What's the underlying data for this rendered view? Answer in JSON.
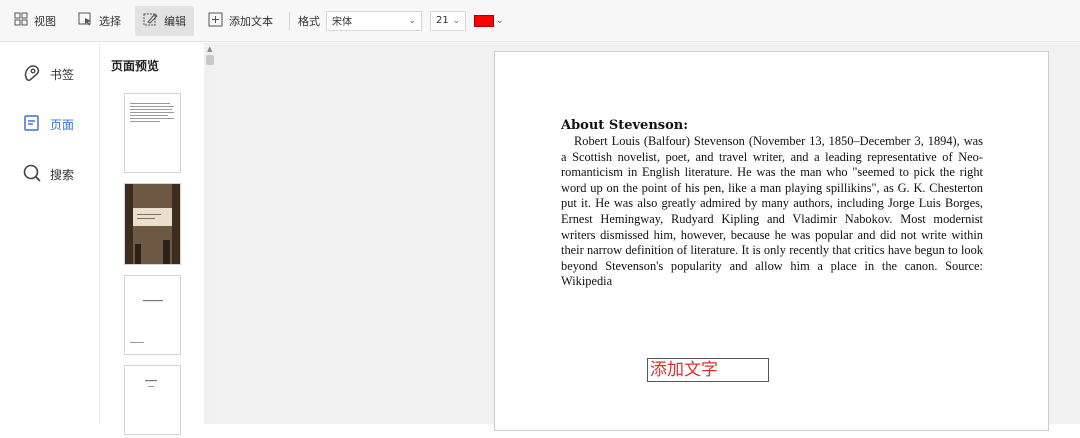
{
  "toolbar": {
    "view_label": "视图",
    "select_label": "选择",
    "edit_label": "编辑",
    "add_text_label": "添加文本",
    "format_label": "格式",
    "font_value": "宋体",
    "size_value": "21",
    "text_color": "#ff0000"
  },
  "sidebar": {
    "items": [
      {
        "label": "书签",
        "icon": "bookmark-icon"
      },
      {
        "label": "页面",
        "icon": "pages-icon"
      },
      {
        "label": "搜索",
        "icon": "search-icon"
      }
    ],
    "active_index": 1
  },
  "thumbnails": {
    "title": "页面预览",
    "count_visible": 4
  },
  "document": {
    "heading": "About Stevenson:",
    "paragraph": "Robert Louis (Balfour) Stevenson (November 13, 1850–December 3, 1894), was a Scottish novelist, poet, and travel writer, and a leading representative of Neo-romanticism in English literature. He was the man who \"seemed to pick the right word up on the point of his pen, like a man playing spillikins\", as G. K. Chesterton put it. He was also greatly admired by many authors, including Jorge Luis Borges, Ernest Hemingway, Rudyard Kipling and Vladimir Nabokov. Most modernist writers dismissed him, however, because he was popular and did not write within their narrow definition of literature. It is only recently that critics have begun to look beyond Stevenson's popularity and allow him a place in the canon. Source: Wikipedia",
    "added_text": "添加文字"
  },
  "colors": {
    "accent": "#3a72d8",
    "added_text_color": "#e03030"
  }
}
